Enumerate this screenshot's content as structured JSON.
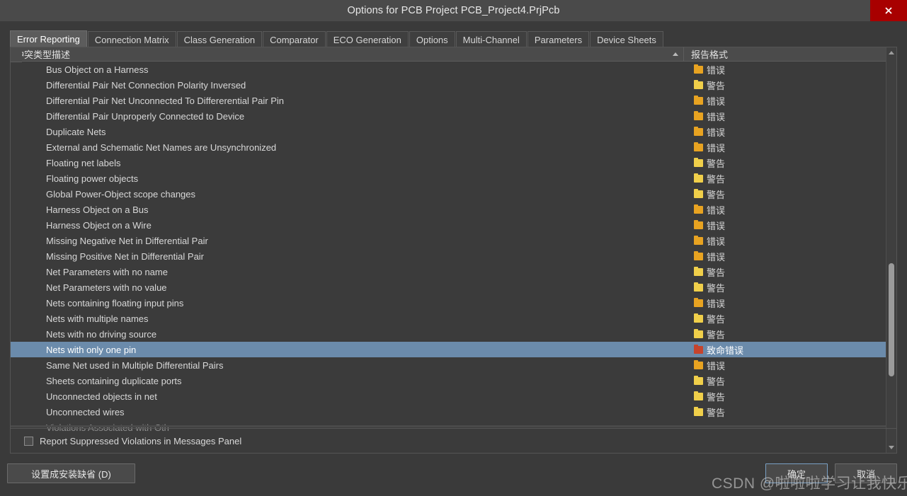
{
  "window": {
    "title": "Options for PCB Project PCB_Project4.PrjPcb",
    "close_icon": "close-icon",
    "close_label": "✕"
  },
  "tabs": [
    {
      "label": "Error Reporting",
      "active": true
    },
    {
      "label": "Connection Matrix",
      "active": false
    },
    {
      "label": "Class Generation",
      "active": false
    },
    {
      "label": "Comparator",
      "active": false
    },
    {
      "label": "ECO Generation",
      "active": false
    },
    {
      "label": "Options",
      "active": false
    },
    {
      "label": "Multi-Channel",
      "active": false
    },
    {
      "label": "Parameters",
      "active": false
    },
    {
      "label": "Device Sheets",
      "active": false
    }
  ],
  "grid": {
    "columns": [
      {
        "label": "冲突类型描述",
        "sorted": true,
        "sort_icon": "sort-ascending-icon"
      },
      {
        "label": "报告格式",
        "sorted": false
      }
    ],
    "rows": [
      {
        "description": "Bus Object on a Harness",
        "format": "错误",
        "level": "err",
        "selected": false
      },
      {
        "description": "Differential Pair Net Connection Polarity Inversed",
        "format": "警告",
        "level": "warn",
        "selected": false
      },
      {
        "description": "Differential Pair Net Unconnected To Differerential Pair Pin",
        "format": "错误",
        "level": "err",
        "selected": false
      },
      {
        "description": "Differential Pair Unproperly Connected to Device",
        "format": "错误",
        "level": "err",
        "selected": false
      },
      {
        "description": "Duplicate Nets",
        "format": "错误",
        "level": "err",
        "selected": false
      },
      {
        "description": "External and Schematic Net Names are Unsynchronized",
        "format": "错误",
        "level": "err",
        "selected": false
      },
      {
        "description": "Floating net labels",
        "format": "警告",
        "level": "warn",
        "selected": false
      },
      {
        "description": "Floating power objects",
        "format": "警告",
        "level": "warn",
        "selected": false
      },
      {
        "description": "Global Power-Object scope changes",
        "format": "警告",
        "level": "warn",
        "selected": false
      },
      {
        "description": "Harness Object on a Bus",
        "format": "错误",
        "level": "err",
        "selected": false
      },
      {
        "description": "Harness Object on a Wire",
        "format": "错误",
        "level": "err",
        "selected": false
      },
      {
        "description": "Missing Negative Net in Differential Pair",
        "format": "错误",
        "level": "err",
        "selected": false
      },
      {
        "description": "Missing Positive Net in Differential Pair",
        "format": "错误",
        "level": "err",
        "selected": false
      },
      {
        "description": "Net Parameters with no name",
        "format": "警告",
        "level": "warn",
        "selected": false
      },
      {
        "description": "Net Parameters with no value",
        "format": "警告",
        "level": "warn",
        "selected": false
      },
      {
        "description": "Nets containing floating input pins",
        "format": "错误",
        "level": "err",
        "selected": false
      },
      {
        "description": "Nets with multiple names",
        "format": "警告",
        "level": "warn",
        "selected": false
      },
      {
        "description": "Nets with no driving source",
        "format": "警告",
        "level": "warn",
        "selected": false
      },
      {
        "description": "Nets with only one pin",
        "format": "致命错误",
        "level": "fatal",
        "selected": true
      },
      {
        "description": "Same Net used in Multiple Differential Pairs",
        "format": "错误",
        "level": "err",
        "selected": false
      },
      {
        "description": "Sheets containing duplicate ports",
        "format": "警告",
        "level": "warn",
        "selected": false
      },
      {
        "description": "Unconnected objects in net",
        "format": "警告",
        "level": "warn",
        "selected": false
      },
      {
        "description": "Unconnected wires",
        "format": "警告",
        "level": "warn",
        "selected": false
      },
      {
        "description": "Violations Associated with Oth",
        "format": "",
        "level": "none",
        "selected": false
      }
    ]
  },
  "options": {
    "report_suppressed_label": "Report Suppressed Violations in Messages Panel",
    "report_suppressed_checked": false
  },
  "footer": {
    "set_as_default_label": "设置成安装缺省 (D)",
    "set_as_default_accel": "D",
    "ok_label": "确定",
    "cancel_label": "取消"
  },
  "watermark": {
    "text": "CSDN @啦啦啦学习让我快乐"
  }
}
